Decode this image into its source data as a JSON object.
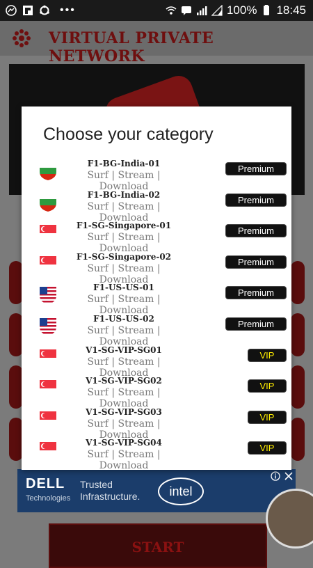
{
  "status_bar": {
    "battery": "100%",
    "time": "18:45"
  },
  "app": {
    "title": "VIRTUAL PRIVATE NETWORK",
    "start_label": "START"
  },
  "dialog": {
    "title": "Choose your category",
    "servers": [
      {
        "name": "F1-BG-India-01",
        "features": "Surf | Stream | Download",
        "tier": "Premium",
        "flag": "bulgaria-flag-icon"
      },
      {
        "name": "F1-BG-India-02",
        "features": "Surf | Stream | Download",
        "tier": "Premium",
        "flag": "bulgaria-flag-icon"
      },
      {
        "name": "F1-SG-Singapore-01",
        "features": "Surf | Stream | Download",
        "tier": "Premium",
        "flag": "singapore-flag-icon"
      },
      {
        "name": "F1-SG-Singapore-02",
        "features": "Surf | Stream | Download",
        "tier": "Premium",
        "flag": "singapore-flag-icon"
      },
      {
        "name": "F1-US-US-01",
        "features": "Surf | Stream | Download",
        "tier": "Premium",
        "flag": "usa-flag-icon"
      },
      {
        "name": "F1-US-US-02",
        "features": "Surf | Stream | Download",
        "tier": "Premium",
        "flag": "usa-flag-icon"
      },
      {
        "name": "V1-SG-VIP-SG01",
        "features": "Surf | Stream | Download",
        "tier": "VIP",
        "flag": "singapore-flag-icon"
      },
      {
        "name": "V1-SG-VIP-SG02",
        "features": "Surf | Stream | Download",
        "tier": "VIP",
        "flag": "singapore-flag-icon"
      },
      {
        "name": "V1-SG-VIP-SG03",
        "features": "Surf | Stream | Download",
        "tier": "VIP",
        "flag": "singapore-flag-icon"
      },
      {
        "name": "V1-SG-VIP-SG04",
        "features": "Surf | Stream | Download",
        "tier": "VIP",
        "flag": "singapore-flag-icon"
      }
    ]
  },
  "ad": {
    "brand": "DELL",
    "brand_sub": "Technologies",
    "text_line1": "Trusted",
    "text_line2": "Infrastructure.",
    "partner": "intel"
  },
  "colors": {
    "accent": "#6e0f0f",
    "premium_badge_text": "#ffffff",
    "vip_badge_text": "#ffee00",
    "badge_bg": "#111111"
  }
}
